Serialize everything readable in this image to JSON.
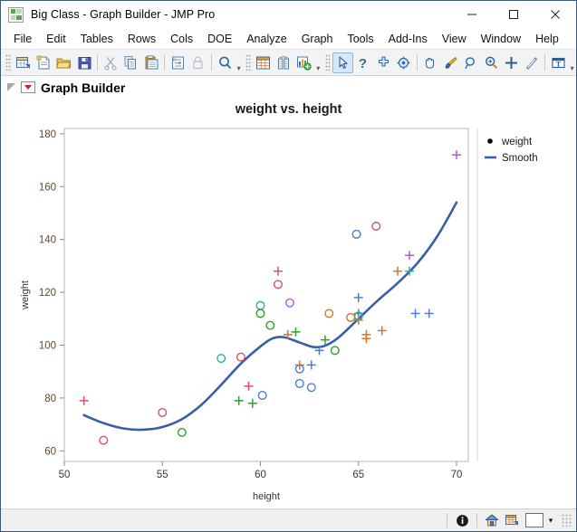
{
  "window": {
    "title": "Big Class - Graph Builder - JMP Pro",
    "app_icon": "jmp-grid-icon",
    "minimize_label": "—",
    "maximize_label": "□",
    "close_label": "✕"
  },
  "menubar": {
    "items": [
      {
        "label": "File"
      },
      {
        "label": "Edit"
      },
      {
        "label": "Tables"
      },
      {
        "label": "Rows"
      },
      {
        "label": "Cols"
      },
      {
        "label": "DOE"
      },
      {
        "label": "Analyze"
      },
      {
        "label": "Graph"
      },
      {
        "label": "Tools"
      },
      {
        "label": "Add-Ins"
      },
      {
        "label": "View"
      },
      {
        "label": "Window"
      },
      {
        "label": "Help"
      }
    ]
  },
  "toolbar": {
    "group1": [
      {
        "icon": "new-data-table-icon",
        "title": "New Data Table"
      },
      {
        "icon": "new-script-icon",
        "title": "New Script"
      },
      {
        "icon": "open-folder-icon",
        "title": "Open"
      },
      {
        "icon": "save-floppy-icon",
        "title": "Save"
      }
    ],
    "group2": [
      {
        "icon": "cut-scissors-icon",
        "title": "Cut"
      },
      {
        "icon": "copy-pages-icon",
        "title": "Copy"
      },
      {
        "icon": "paste-clipboard-icon",
        "title": "Paste"
      }
    ],
    "group3": [
      {
        "icon": "journal-icon",
        "title": "Journal"
      },
      {
        "icon": "lock-icon",
        "title": "Lock"
      }
    ],
    "group4": [
      {
        "icon": "search-magnifier-icon",
        "title": "Search"
      }
    ],
    "group5": [
      {
        "icon": "data-table-grid-icon",
        "title": "Data Table"
      },
      {
        "icon": "columns-icon",
        "title": "Columns"
      },
      {
        "icon": "add-graph-icon",
        "title": "Add Graph"
      }
    ],
    "group6": [
      {
        "icon": "arrow-select-icon",
        "title": "Select",
        "active": true
      },
      {
        "icon": "question-help-icon",
        "title": "Help"
      },
      {
        "icon": "crosshair-icon",
        "title": "Crosshairs"
      },
      {
        "icon": "target-icon",
        "title": "Annotate Target"
      }
    ],
    "group7": [
      {
        "icon": "hand-grabber-icon",
        "title": "Grabber"
      },
      {
        "icon": "brush-icon",
        "title": "Brush"
      },
      {
        "icon": "lasso-icon",
        "title": "Lasso"
      },
      {
        "icon": "magnifier-zoom-icon",
        "title": "Magnifier"
      },
      {
        "icon": "plus-crosshair-icon",
        "title": "Crosshair Tool"
      },
      {
        "icon": "line-tool-icon",
        "title": "Line"
      }
    ],
    "group8": [
      {
        "icon": "text-annotate-icon",
        "title": "Annotate"
      }
    ],
    "overflow_label": "▾"
  },
  "report": {
    "title": "Graph Builder",
    "disclosure_icon": "disclosure-triangle-icon",
    "menu_icon": "red-triangle-menu-icon"
  },
  "statusbar": {
    "info_icon": "info-icon",
    "home_icon": "home-icon",
    "datatable_icon": "data-table-icon",
    "color_swatch": "#ffffff",
    "caret_label": "▾"
  },
  "chart_data": {
    "type": "scatter",
    "title": "weight vs. height",
    "xlabel": "height",
    "ylabel": "weight",
    "xlim": [
      50,
      70.6
    ],
    "ylim": [
      56,
      182
    ],
    "xticks": [
      50,
      55,
      60,
      65,
      70
    ],
    "yticks": [
      60,
      80,
      100,
      120,
      140,
      160,
      180
    ],
    "grid": false,
    "legend": {
      "position": "right",
      "entries": [
        {
          "label": "weight",
          "marker": "dot",
          "color": "#000000"
        },
        {
          "label": "Smooth",
          "marker": "line",
          "color": "#3b5ea8"
        }
      ]
    },
    "series": [
      {
        "name": "weight",
        "marker_colors_note": "markers colored by a categorical grouping; shapes are circle (o) and plus (+)",
        "points": [
          {
            "x": 51.0,
            "y": 79.0,
            "marker": "plus",
            "color": "#d4546a"
          },
          {
            "x": 52.0,
            "y": 64.0,
            "marker": "circle",
            "color": "#d4546a"
          },
          {
            "x": 55.0,
            "y": 74.5,
            "marker": "circle",
            "color": "#d4546a"
          },
          {
            "x": 56.0,
            "y": 67.0,
            "marker": "circle",
            "color": "#2ea02e"
          },
          {
            "x": 58.0,
            "y": 95.0,
            "marker": "circle",
            "color": "#2eaf8f"
          },
          {
            "x": 58.9,
            "y": 79.0,
            "marker": "plus",
            "color": "#2ea02e"
          },
          {
            "x": 59.0,
            "y": 95.5,
            "marker": "circle",
            "color": "#d4546a"
          },
          {
            "x": 59.4,
            "y": 84.5,
            "marker": "plus",
            "color": "#d4546a"
          },
          {
            "x": 59.6,
            "y": 78.0,
            "marker": "plus",
            "color": "#2ea02e"
          },
          {
            "x": 60.0,
            "y": 115.0,
            "marker": "circle",
            "color": "#2eaf8f"
          },
          {
            "x": 60.0,
            "y": 112.0,
            "marker": "circle",
            "color": "#2ea02e"
          },
          {
            "x": 60.1,
            "y": 81.0,
            "marker": "circle",
            "color": "#4a7fd4"
          },
          {
            "x": 60.5,
            "y": 107.5,
            "marker": "circle",
            "color": "#2ea02e"
          },
          {
            "x": 60.9,
            "y": 128.0,
            "marker": "plus",
            "color": "#d4546a"
          },
          {
            "x": 60.9,
            "y": 123.0,
            "marker": "circle",
            "color": "#d4546a"
          },
          {
            "x": 61.5,
            "y": 116.0,
            "marker": "circle",
            "color": "#b05ad0"
          },
          {
            "x": 61.4,
            "y": 104.0,
            "marker": "plus",
            "color": "#c97a2a"
          },
          {
            "x": 61.8,
            "y": 105.0,
            "marker": "plus",
            "color": "#2ea02e"
          },
          {
            "x": 62.0,
            "y": 92.5,
            "marker": "plus",
            "color": "#c97a2a"
          },
          {
            "x": 62.0,
            "y": 91.0,
            "marker": "circle",
            "color": "#4a7fd4"
          },
          {
            "x": 62.0,
            "y": 85.5,
            "marker": "circle",
            "color": "#4a7fd4"
          },
          {
            "x": 62.6,
            "y": 84.0,
            "marker": "circle",
            "color": "#4a7fd4"
          },
          {
            "x": 62.6,
            "y": 92.5,
            "marker": "plus",
            "color": "#4a7fd4"
          },
          {
            "x": 63.0,
            "y": 98.0,
            "marker": "plus",
            "color": "#4a7fd4"
          },
          {
            "x": 63.3,
            "y": 102.0,
            "marker": "plus",
            "color": "#2ea02e"
          },
          {
            "x": 63.5,
            "y": 112.0,
            "marker": "circle",
            "color": "#c97a2a"
          },
          {
            "x": 63.8,
            "y": 98.0,
            "marker": "circle",
            "color": "#2ea02e"
          },
          {
            "x": 64.9,
            "y": 142.0,
            "marker": "circle",
            "color": "#4a7fd4"
          },
          {
            "x": 65.0,
            "y": 118.0,
            "marker": "plus",
            "color": "#4a7fd4"
          },
          {
            "x": 65.0,
            "y": 112.0,
            "marker": "plus",
            "color": "#4a7fd4"
          },
          {
            "x": 65.0,
            "y": 111.0,
            "marker": "circle",
            "color": "#4a7fd4"
          },
          {
            "x": 65.0,
            "y": 111.0,
            "marker": "circle",
            "color": "#2eaf8f"
          },
          {
            "x": 65.0,
            "y": 109.5,
            "marker": "plus",
            "color": "#c97a2a"
          },
          {
            "x": 64.6,
            "y": 110.5,
            "marker": "circle",
            "color": "#c97a2a"
          },
          {
            "x": 65.4,
            "y": 104.0,
            "marker": "plus",
            "color": "#c97a2a"
          },
          {
            "x": 65.4,
            "y": 102.5,
            "marker": "plus",
            "color": "#c97a2a"
          },
          {
            "x": 65.9,
            "y": 145.0,
            "marker": "circle",
            "color": "#d4546a"
          },
          {
            "x": 66.2,
            "y": 105.5,
            "marker": "plus",
            "color": "#c97a2a"
          },
          {
            "x": 67.0,
            "y": 128.0,
            "marker": "plus",
            "color": "#c97a2a"
          },
          {
            "x": 67.6,
            "y": 128.0,
            "marker": "plus",
            "color": "#2eaf8f"
          },
          {
            "x": 67.6,
            "y": 134.0,
            "marker": "plus",
            "color": "#b05ad0"
          },
          {
            "x": 67.9,
            "y": 112.0,
            "marker": "plus",
            "color": "#4a7fd4"
          },
          {
            "x": 68.6,
            "y": 112.0,
            "marker": "plus",
            "color": "#4a7fd4"
          },
          {
            "x": 70.0,
            "y": 172.0,
            "marker": "plus",
            "color": "#b05ad0"
          }
        ]
      },
      {
        "name": "Smooth",
        "type": "line",
        "color": "#3b5ea8",
        "points": [
          {
            "x": 51.0,
            "y": 73.5
          },
          {
            "x": 52.0,
            "y": 70.5
          },
          {
            "x": 53.0,
            "y": 68.5
          },
          {
            "x": 54.0,
            "y": 68.0
          },
          {
            "x": 55.0,
            "y": 69.0
          },
          {
            "x": 56.0,
            "y": 72.0
          },
          {
            "x": 57.0,
            "y": 77.5
          },
          {
            "x": 58.0,
            "y": 85.0
          },
          {
            "x": 59.0,
            "y": 93.0
          },
          {
            "x": 60.0,
            "y": 99.5
          },
          {
            "x": 60.6,
            "y": 102.5
          },
          {
            "x": 61.2,
            "y": 103.0
          },
          {
            "x": 62.0,
            "y": 101.0
          },
          {
            "x": 62.7,
            "y": 99.3
          },
          {
            "x": 63.3,
            "y": 99.8
          },
          {
            "x": 64.0,
            "y": 103.0
          },
          {
            "x": 65.0,
            "y": 110.0
          },
          {
            "x": 66.0,
            "y": 117.0
          },
          {
            "x": 67.0,
            "y": 123.5
          },
          {
            "x": 68.0,
            "y": 131.0
          },
          {
            "x": 69.0,
            "y": 141.0
          },
          {
            "x": 70.0,
            "y": 154.0
          }
        ]
      }
    ]
  }
}
